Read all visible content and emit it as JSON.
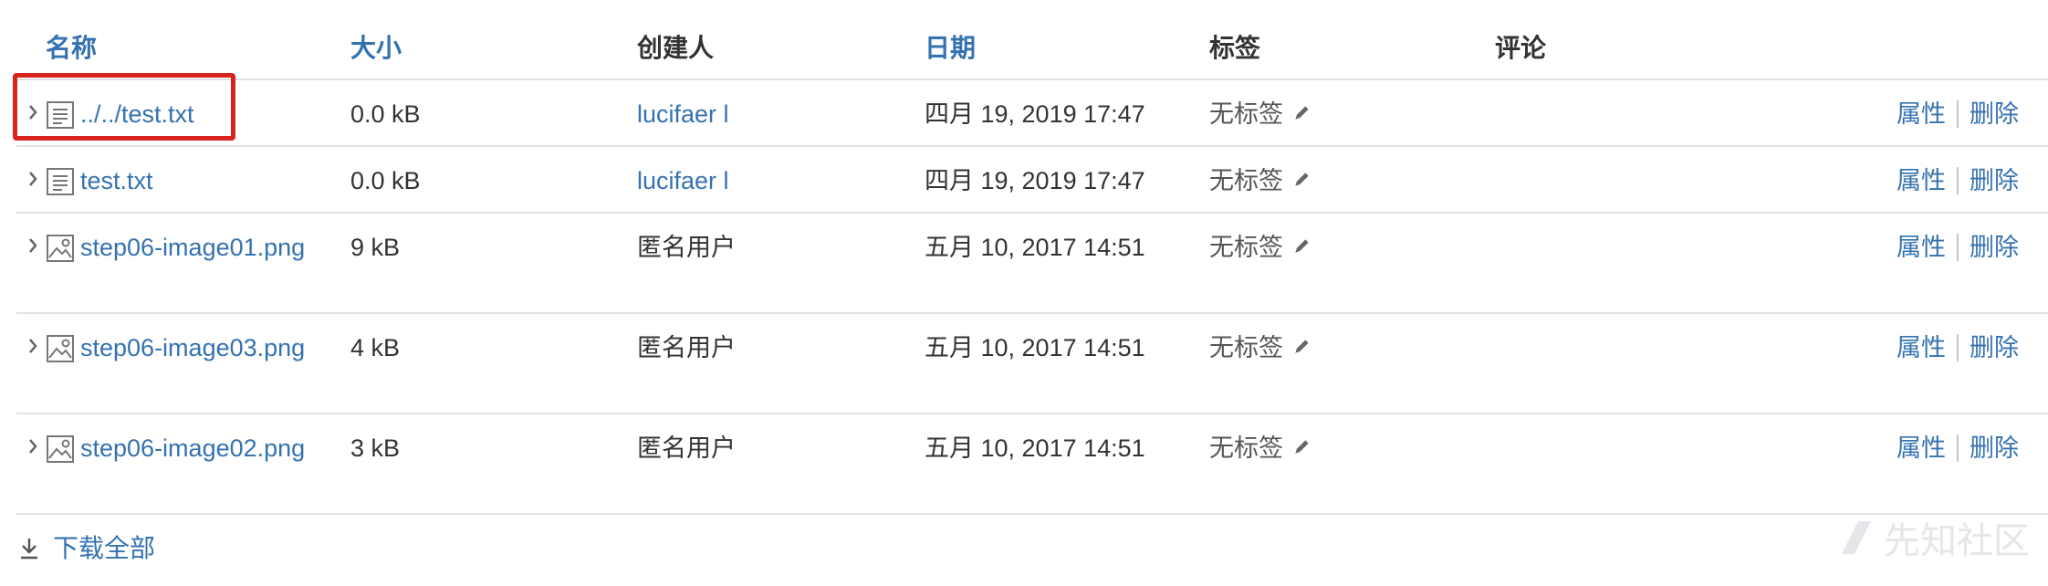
{
  "columns": {
    "name": "名称",
    "size": "大小",
    "creator": "创建人",
    "date": "日期",
    "tags": "标签",
    "comments": "评论"
  },
  "files": [
    {
      "name": "../../test.txt",
      "type": "text",
      "size": "0.0 kB",
      "creator": "lucifaer l",
      "creator_is_link": true,
      "date": "四月 19, 2019 17:47",
      "tags": "无标签"
    },
    {
      "name": "test.txt",
      "type": "text",
      "size": "0.0 kB",
      "creator": "lucifaer l",
      "creator_is_link": true,
      "date": "四月 19, 2019 17:47",
      "tags": "无标签"
    },
    {
      "name": "step06-image01.png",
      "type": "image",
      "size": "9 kB",
      "creator": "匿名用户",
      "creator_is_link": false,
      "date": "五月 10, 2017 14:51",
      "tags": "无标签"
    },
    {
      "name": "step06-image03.png",
      "type": "image",
      "size": "4 kB",
      "creator": "匿名用户",
      "creator_is_link": false,
      "date": "五月 10, 2017 14:51",
      "tags": "无标签"
    },
    {
      "name": "step06-image02.png",
      "type": "image",
      "size": "3 kB",
      "creator": "匿名用户",
      "creator_is_link": false,
      "date": "五月 10, 2017 14:51",
      "tags": "无标签"
    }
  ],
  "actions": {
    "properties": "属性",
    "delete": "删除"
  },
  "download_all": "下载全部",
  "watermark": "先知社区",
  "colors": {
    "link": "#3572b0",
    "highlight": "#d9231f",
    "divider": "#dfe1e6"
  }
}
